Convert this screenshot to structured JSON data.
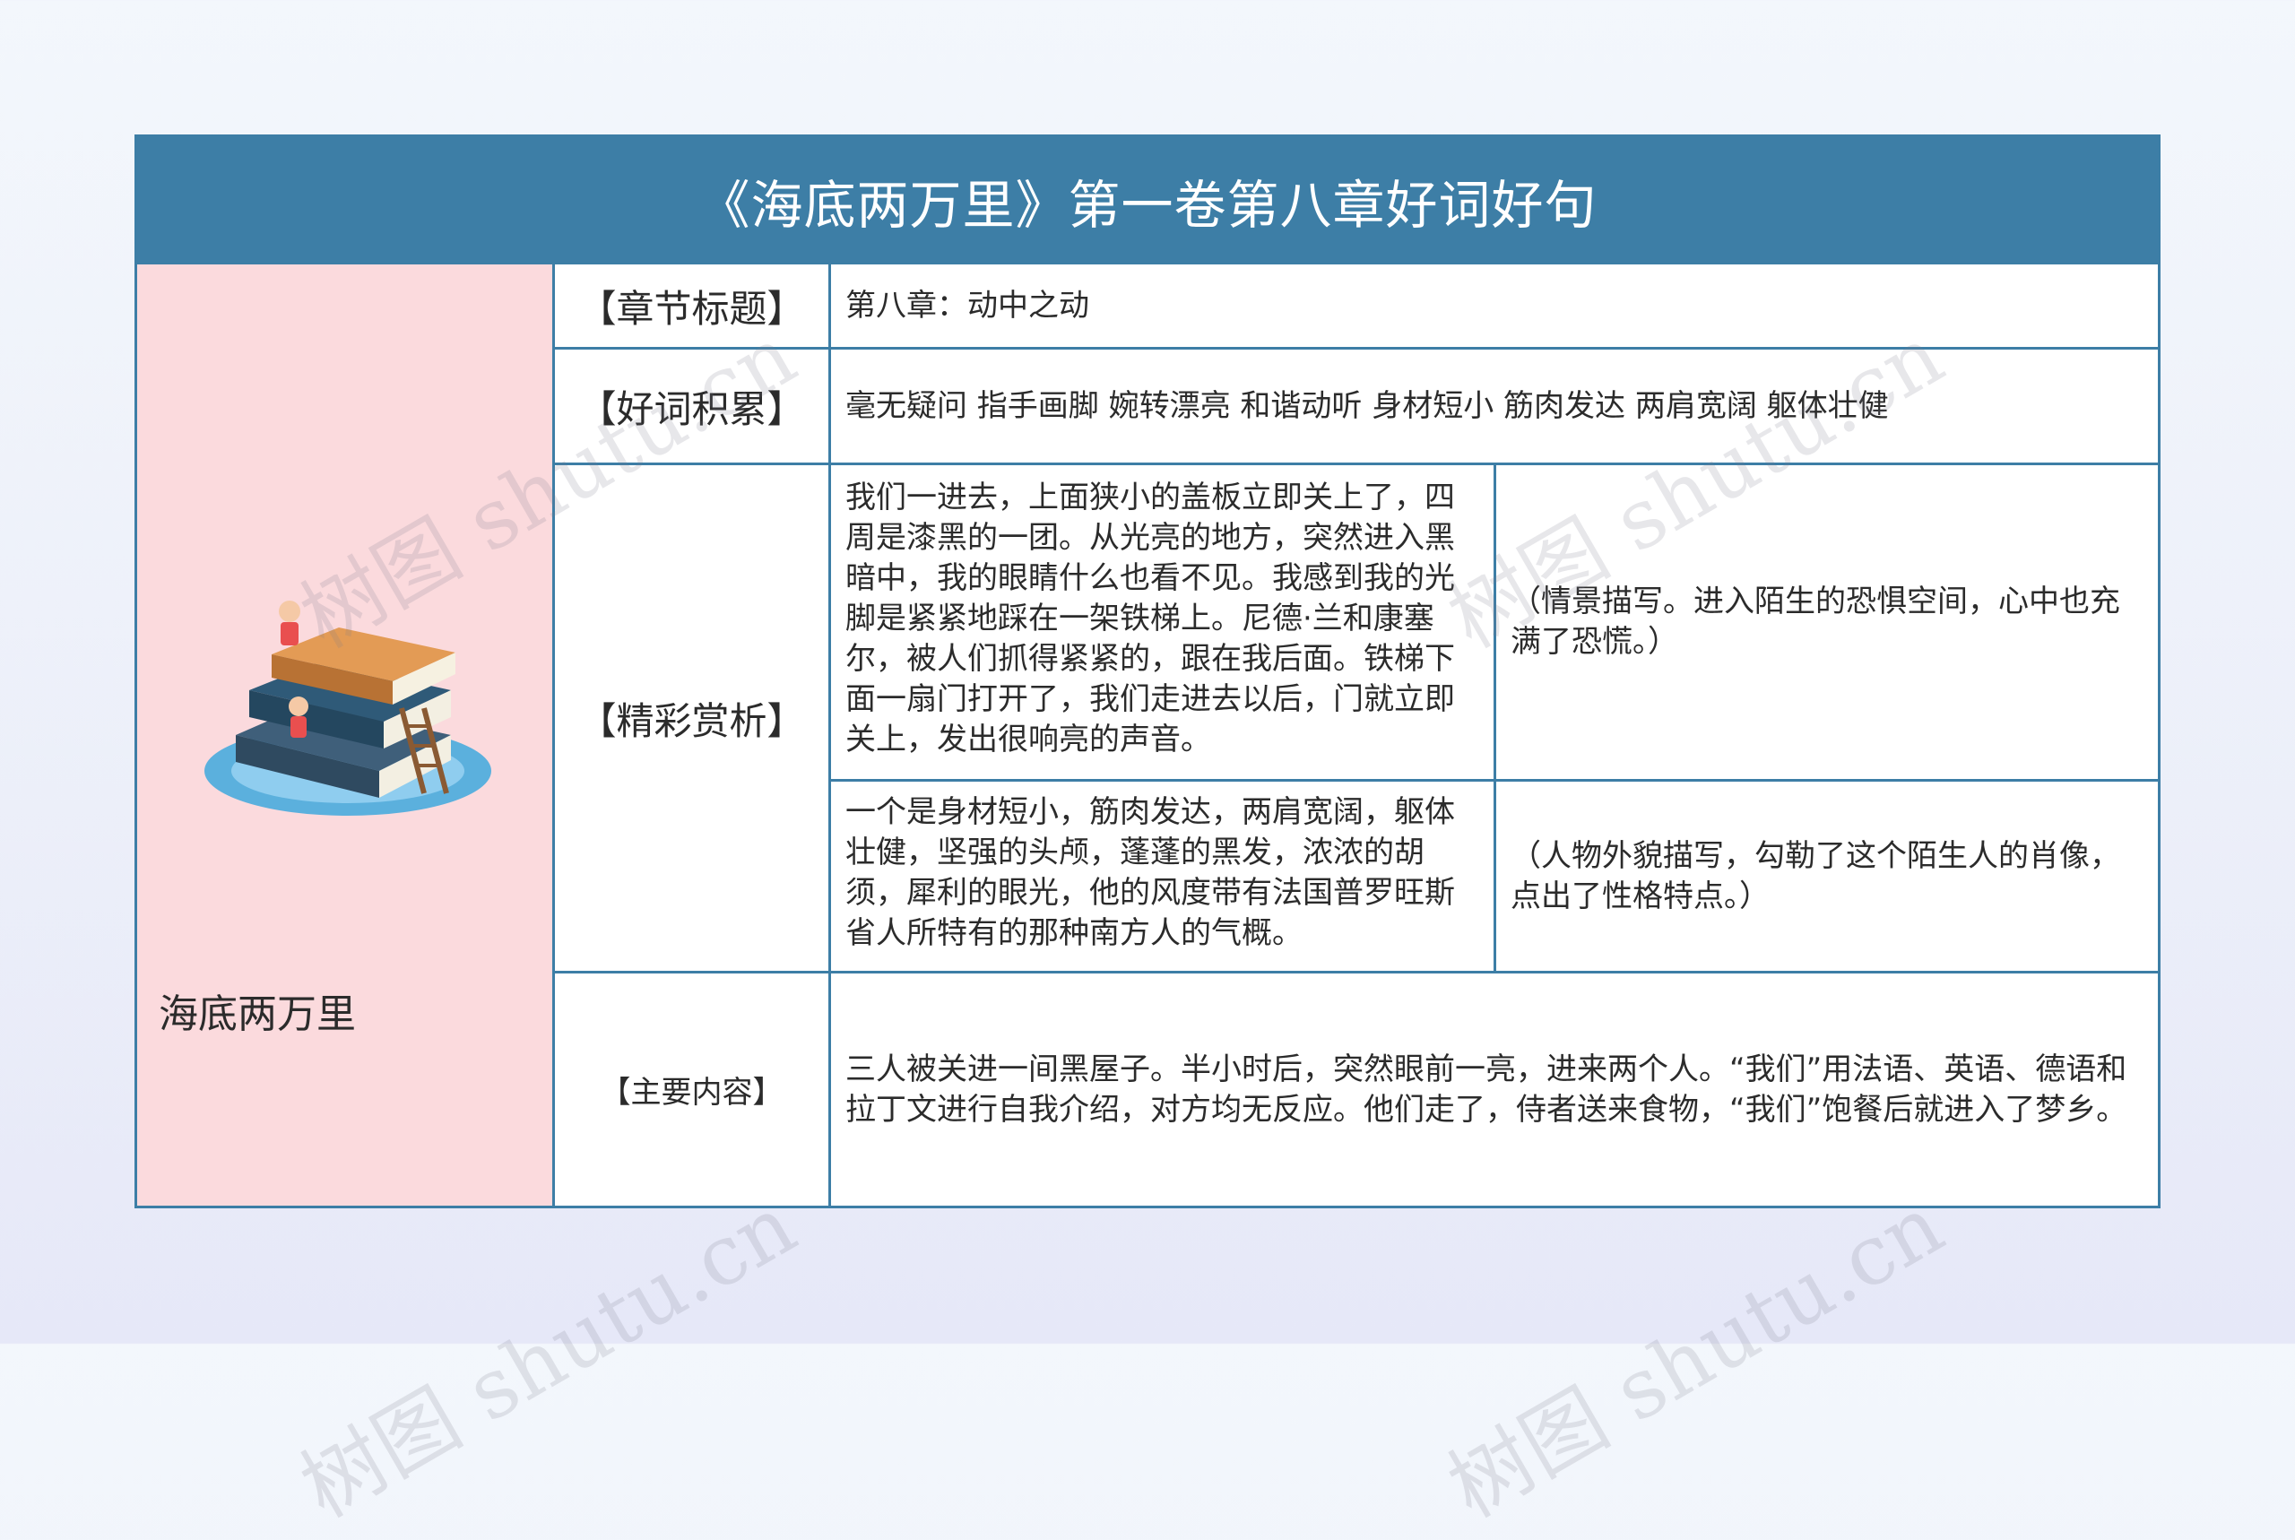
{
  "title": "《海底两万里》第一卷第八章好词好句",
  "topic": "海底两万里",
  "labels": {
    "chapter_title": "【章节标题】",
    "good_words": "【好词积累】",
    "highlight_analysis": "【精彩赏析】",
    "main_content": "【主要内容】"
  },
  "chapter_title": "第八章：动中之动",
  "good_words": "毫无疑问 指手画脚 婉转漂亮 和谐动听 身材短小 筋肉发达 两肩宽阔 躯体壮健",
  "analysis": [
    {
      "quote": "我们一进去，上面狭小的盖板立即关上了，四周是漆黑的一团。从光亮的地方，突然进入黑暗中，我的眼睛什么也看不见。我感到我的光脚是紧紧地踩在一架铁梯上。尼德·兰和康塞尔，被人们抓得紧紧的，跟在我后面。铁梯下面一扇门打开了，我们走进去以后，门就立即关上，发出很响亮的声音。",
      "comment": "（情景描写。进入陌生的恐惧空间，心中也充满了恐慌。）"
    },
    {
      "quote": "一个是身材短小，筋肉发达，两肩宽阔，躯体壮健，坚强的头颅，蓬蓬的黑发，浓浓的胡须，犀利的眼光，他的风度带有法国普罗旺斯省人所特有的那种南方人的气概。",
      "comment": "（人物外貌描写，勾勒了这个陌生人的肖像，点出了性格特点。）"
    }
  ],
  "main_content": "三人被关进一间黑屋子。半小时后，突然眼前一亮，进来两个人。“我们”用法语、英语、德语和拉丁文进行自我介绍，对方均无反应。他们走了，侍者送来食物，“我们”饱餐后就进入了梦乡。",
  "watermark": "树图 shutu.cn",
  "colors": {
    "accent": "#3d7ea6",
    "left_panel": "#fbdadd",
    "background": "#eef2fb"
  }
}
